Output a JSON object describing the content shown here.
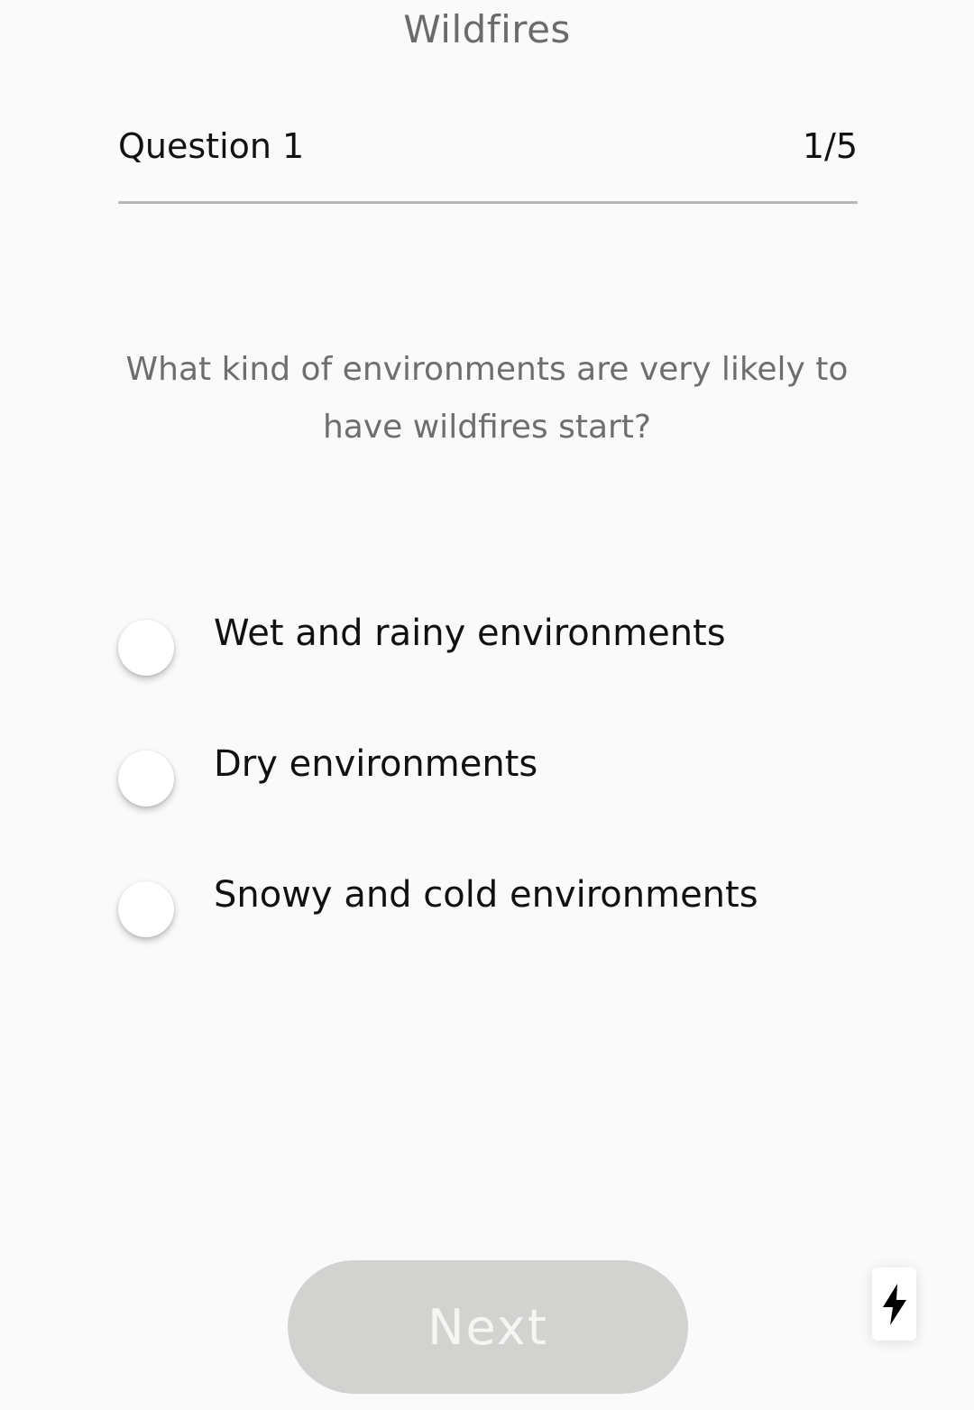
{
  "header": {
    "title": "Wildfires"
  },
  "quiz": {
    "question_label": "Question 1",
    "progress": "1/5",
    "question_text": "What kind of environments are very likely to have wildfires start?",
    "options": [
      {
        "label": "Wet and rainy environments",
        "selected": false
      },
      {
        "label": "Dry environments",
        "selected": false
      },
      {
        "label": "Snowy and cold environments",
        "selected": false
      }
    ]
  },
  "footer": {
    "next_label": "Next",
    "next_enabled": false,
    "fab_icon": "lightning-bolt-icon"
  },
  "colors": {
    "background": "#fafafa",
    "title_text": "#6b6b6b",
    "question_text": "#6e6e6e",
    "divider": "#b7b7b7",
    "button_disabled_bg": "#d2d3d1",
    "button_disabled_text": "#f5f5f3"
  }
}
